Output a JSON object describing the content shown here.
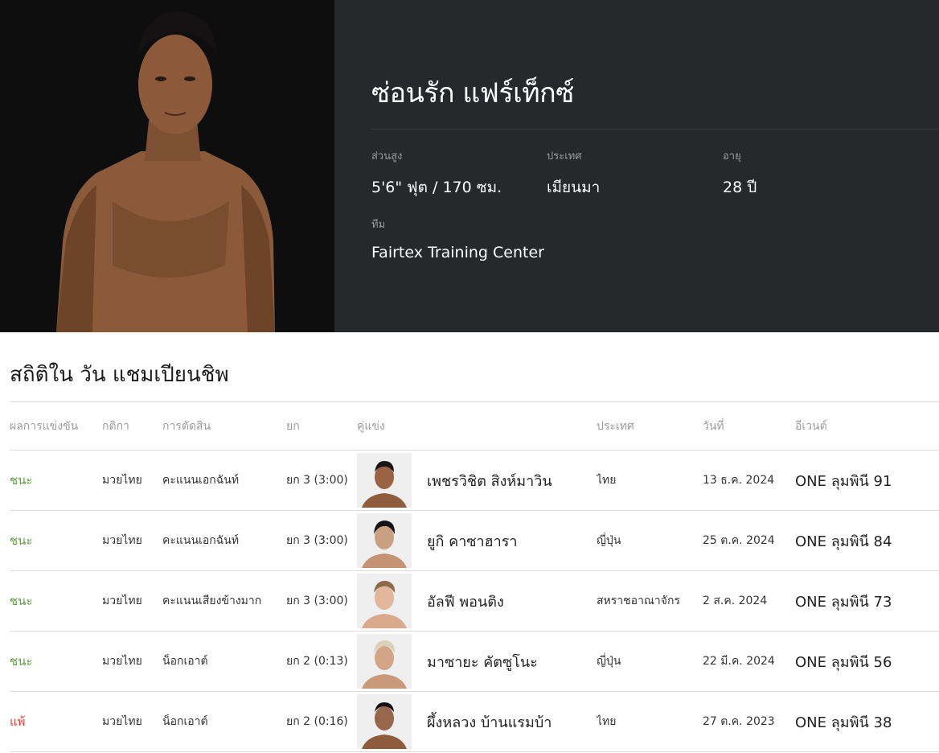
{
  "hero": {
    "fighter_name": "ซ่อนรัก แฟร์เท็กซ์",
    "attributes": [
      {
        "label": "ส่วนสูง",
        "value": "5'6\" ฟุต / 170 ซม."
      },
      {
        "label": "ประเทศ",
        "value": "เมียนมา"
      },
      {
        "label": "อายุ",
        "value": "28 ปี"
      },
      {
        "label": "ทีม",
        "value": "Fairtex Training Center"
      }
    ]
  },
  "stats": {
    "title": "สถิติใน วัน แชมเปียนชิพ",
    "headers": [
      "ผลการแข่งขัน",
      "กติกา",
      "การตัดสิน",
      "ยก",
      "คู่แข่ง",
      "ประเทศ",
      "วันที่",
      "อีเวนต์"
    ],
    "rows": [
      {
        "result": "ชนะ",
        "rules": "มวยไทย",
        "method": "คะแนนเอกฉันท์",
        "round": "ยก 3 (3:00)",
        "opponent": "เพชรวิชิต สิงห์มาวิน",
        "country": "ไทย",
        "date": "13 ธ.ค. 2024",
        "event": "ONE ลุมพินี 91"
      },
      {
        "result": "ชนะ",
        "rules": "มวยไทย",
        "method": "คะแนนเอกฉันท์",
        "round": "ยก 3 (3:00)",
        "opponent": "ยูกิ คาซาฮารา",
        "country": "ญี่ปุ่น",
        "date": "25 ต.ค. 2024",
        "event": "ONE ลุมพินี 84"
      },
      {
        "result": "ชนะ",
        "rules": "มวยไทย",
        "method": "คะแนนเสียงข้างมาก",
        "round": "ยก 3 (3:00)",
        "opponent": "อัลฟี พอนติง",
        "country": "สหราชอาณาจักร",
        "date": "2 ส.ค. 2024",
        "event": "ONE ลุมพินี 73"
      },
      {
        "result": "ชนะ",
        "rules": "มวยไทย",
        "method": "น็อกเอาต์",
        "round": "ยก 2 (0:13)",
        "opponent": "มาซายะ คัตซูโนะ",
        "country": "ญี่ปุ่น",
        "date": "22 มี.ค. 2024",
        "event": "ONE ลุมพินี 56"
      },
      {
        "result": "แพ้",
        "rules": "มวยไทย",
        "method": "น็อกเอาต์",
        "round": "ยก 2 (0:16)",
        "opponent": "ผึ้งหลวง บ้านแรมบ้า",
        "country": "ไทย",
        "date": "27 ต.ค. 2023",
        "event": "ONE ลุมพินี 38"
      }
    ]
  },
  "colors": {
    "win": "#5aa33d",
    "loss": "#d9453d",
    "hero_bg": "#27282b"
  }
}
